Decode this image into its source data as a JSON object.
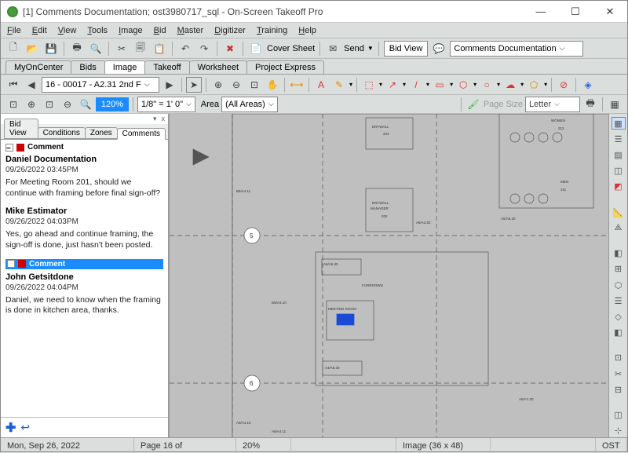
{
  "window": {
    "title": "[1] Comments Documentation; ost3980717_sql - On-Screen Takeoff Pro"
  },
  "menu": [
    "File",
    "Edit",
    "View",
    "Tools",
    "Image",
    "Bid",
    "Master",
    "Digitizer",
    "Training",
    "Help"
  ],
  "toolbar1": {
    "coversheet": "Cover Sheet",
    "send": "Send",
    "bidview": "Bid View",
    "docname": "Comments Documentation"
  },
  "maintabs": [
    "MyOnCenter",
    "Bids",
    "Image",
    "Takeoff",
    "Worksheet",
    "Project Express"
  ],
  "pagecombo": "16 - 00017 - A2.31 2nd F",
  "scalecombo": "1/8\" = 1' 0\"",
  "arealbl": "Area",
  "areaval": "(All Areas)",
  "pagesize": "Page Size",
  "paper": "Letter",
  "zoompct": "120%",
  "sidetabs": [
    "Bid View",
    "Conditions",
    "Zones",
    "Comments"
  ],
  "comments": [
    {
      "label": "Comment",
      "author": "Daniel Documentation",
      "ts": "09/26/2022 03:45PM",
      "body": "For Meeting Room 201, should we continue with framing before final sign-off?",
      "selected": false
    },
    {
      "label": "",
      "author": "Mike Estimator",
      "ts": "09/26/2022 04:03PM",
      "body": "Yes, go ahead and continue framing, the sign-off is done, just hasn't been posted.",
      "selected": false
    },
    {
      "label": "Comment",
      "author": "John Getsitdone",
      "ts": "09/26/2022 04:04PM",
      "body": "Daniel, we need to know when the framing is done in kitchen area, thanks.",
      "selected": true
    }
  ],
  "status": {
    "date": "Mon, Sep 26, 2022",
    "page": "Page 16 of",
    "zoom": "20%",
    "image": "Image (36 x 48)",
    "mode": "OST"
  },
  "rooms": {
    "drywall": "DRYWALL",
    "drywall_manager": "DRYWALL MANAGER",
    "meeting": "MEETING ROOM",
    "furrdown": "FURRDOWN",
    "women": "WOMEN",
    "men": "MEN",
    "n203": "203",
    "n202": "202",
    "n212": "212",
    "n211": "211",
    "circle5": "5",
    "circle6": "6",
    "a5a520": "A5/A5.20",
    "a5a530": "A5/A5.30",
    "a6a410": "A6/A4.10",
    "a6a411": "A6/A4.11",
    "d6a410": "D6/A4.10",
    "b6a411": "B6/A4.11",
    "a3a530": "A3/A5.30",
    "a5a720": "A5/A7.20",
    "a6a282": "A6/A2.82"
  }
}
